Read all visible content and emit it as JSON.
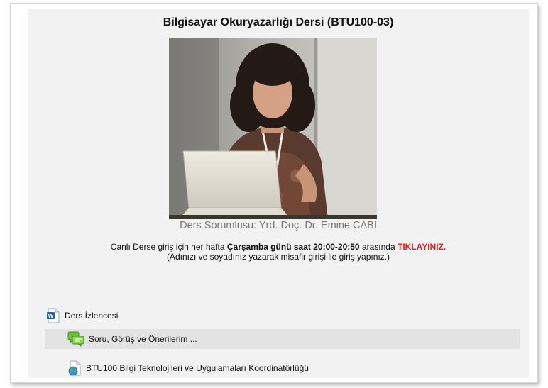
{
  "course": {
    "title": "Bilgisayar Okuryazarlığı Dersi (BTU100-03)",
    "instructor": "Ders Sorumlusu: Yrd. Doç. Dr. Emine CABI"
  },
  "live_session": {
    "intro_text": "Canlı Derse giriş için her hafta ",
    "schedule_bold": "Çarşamba günü saat 20:00-20:50",
    "middle_text": " arasında ",
    "link_label": "TIKLAYINIZ.",
    "guest_note": "(Adınızı ve soyadınız yazarak misafir girişi ile giriş yapınız.)"
  },
  "activities": [
    {
      "label": "Ders İzlencesi",
      "icon": "word-document-icon"
    },
    {
      "label": "Soru, Görüş ve Önerilerim ...",
      "icon": "forum-icon"
    },
    {
      "label": "BTU100 Bilgi Teknolojileri ve Uygulamaları Koordinatörlüğü",
      "icon": "globe-page-icon"
    }
  ],
  "colors": {
    "link_red": "#e02020",
    "instructor_gray": "#777777",
    "content_bg": "#f2f2f2",
    "highlight_row_bg": "#e3e3e3"
  }
}
